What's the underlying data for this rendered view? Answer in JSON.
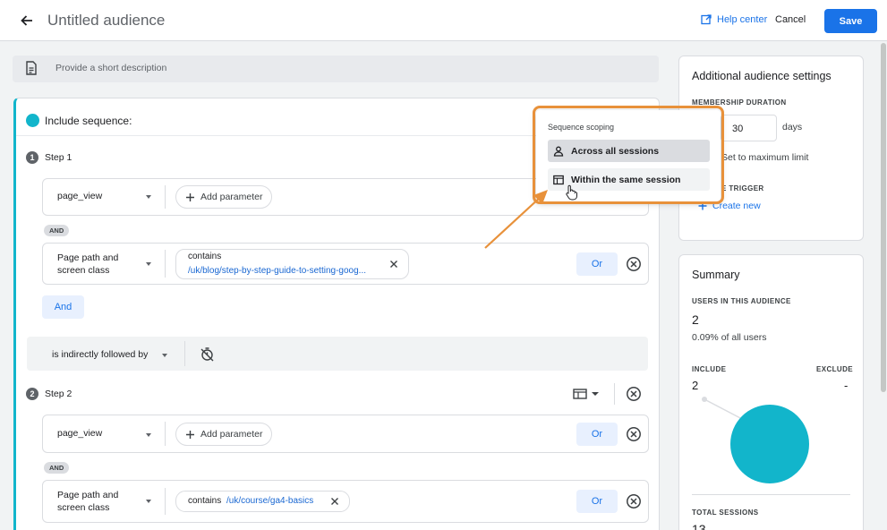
{
  "header": {
    "title": "Untitled audience",
    "help_label": "Help center",
    "cancel_label": "Cancel",
    "save_label": "Save"
  },
  "description": {
    "placeholder": "Provide a short description"
  },
  "sequence": {
    "title": "Include sequence:",
    "steps": [
      {
        "number": "1",
        "label": "Step 1",
        "rows": [
          {
            "dimension": "page_view",
            "add_param": "Add parameter"
          },
          {
            "dimension": "Page path and screen class",
            "operator": "contains",
            "value": "/uk/blog/step-by-step-guide-to-setting-goog...",
            "or_label": "Or"
          }
        ],
        "and_pill": "AND",
        "and_button": "And"
      },
      {
        "number": "2",
        "label": "Step 2",
        "rows": [
          {
            "dimension": "page_view",
            "add_param": "Add parameter",
            "or_label": "Or"
          },
          {
            "dimension": "Page path and screen class",
            "operator": "contains",
            "value": "/uk/course/ga4-basics",
            "or_label": "Or"
          }
        ],
        "and_pill": "AND"
      }
    ],
    "followed_by": "is indirectly followed by"
  },
  "scoping_popup": {
    "title": "Sequence scoping",
    "options": [
      "Across all sessions",
      "Within the same session"
    ]
  },
  "settings": {
    "title": "Additional audience settings",
    "duration_caption": "MEMBERSHIP DURATION",
    "duration_value": "30",
    "duration_unit": "days",
    "max_limit_label": "Set to maximum limit",
    "trigger_caption": "E TRIGGER",
    "create_new": "Create new"
  },
  "summary": {
    "title": "Summary",
    "users_caption": "USERS IN THIS AUDIENCE",
    "users_value": "2",
    "users_pct": "0.09% of all users",
    "include_caption": "INCLUDE",
    "exclude_caption": "EXCLUDE",
    "include_value": "2",
    "exclude_value": "-",
    "sessions_caption": "TOTAL SESSIONS",
    "sessions_value": "13"
  },
  "colors": {
    "accent": "#1a73e8",
    "teal": "#12b5cb",
    "highlight": "#e8913a"
  }
}
